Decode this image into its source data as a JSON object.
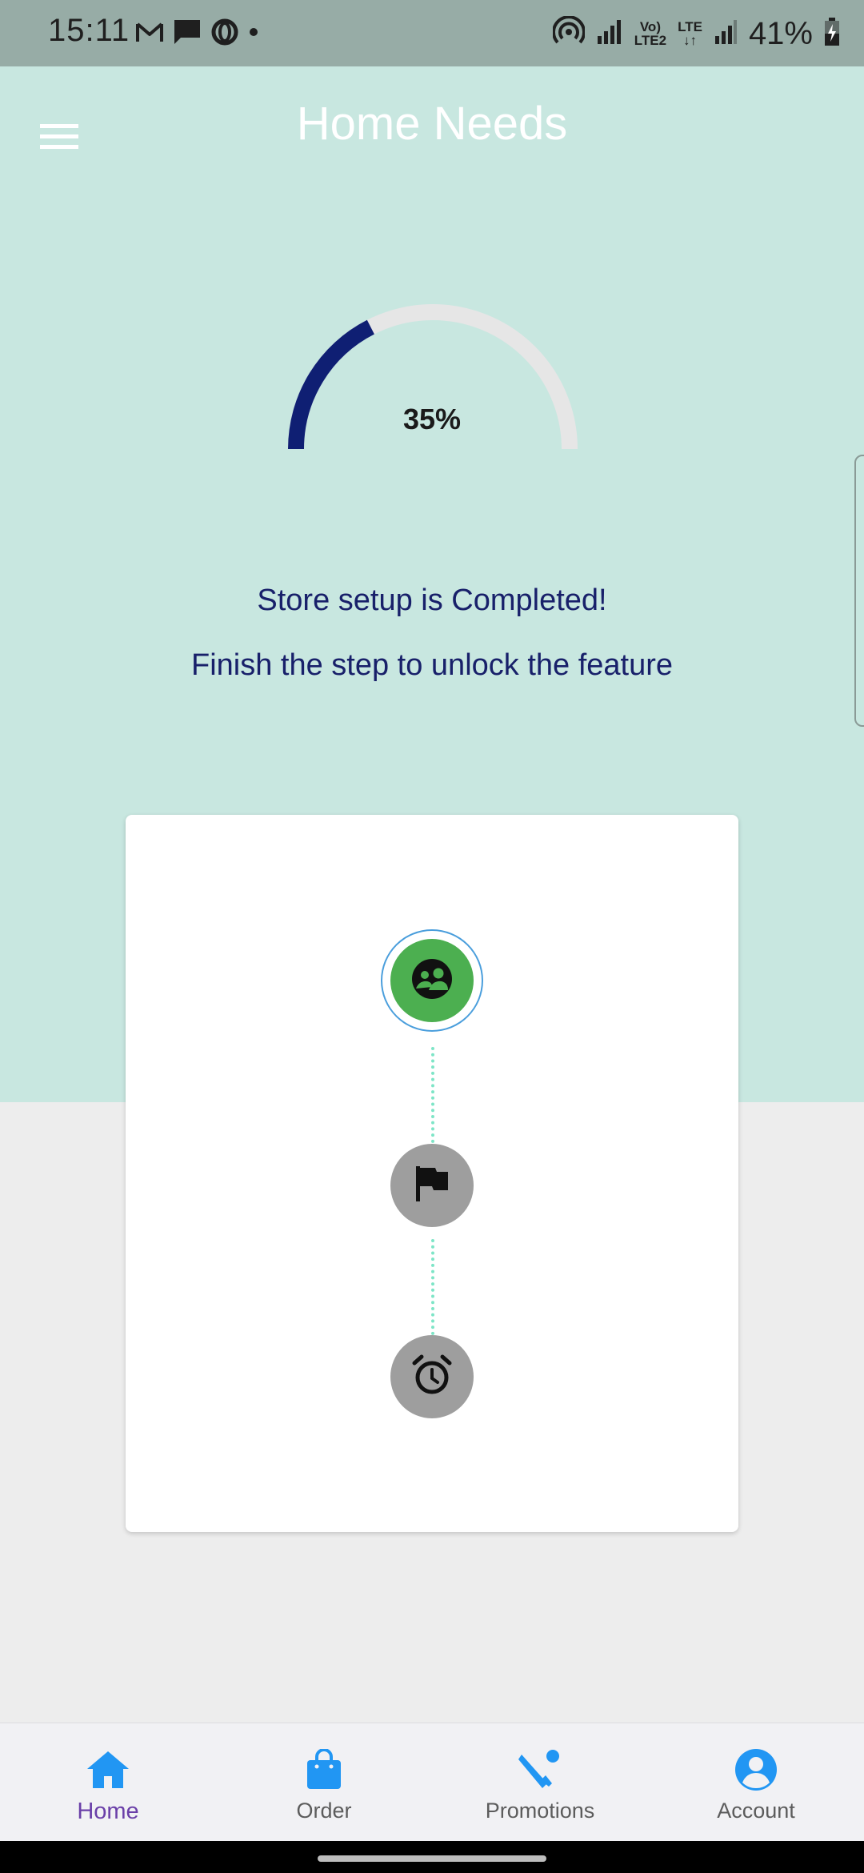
{
  "status_bar": {
    "time": "15:11",
    "battery": "41%",
    "lte_line1": "Vo)",
    "lte_line2": "LTE2",
    "lte_label": "LTE",
    "icons": [
      "gmail-icon",
      "message-icon",
      "opera-icon",
      "dot-icon",
      "hotspot-icon",
      "signal-icon",
      "signal-icon",
      "battery-charging-icon"
    ]
  },
  "header": {
    "title": "Home Needs",
    "menu_icon": "hamburger-menu-icon"
  },
  "progress": {
    "value_percent": 35,
    "label": "35%",
    "fill_color": "#0f1f73",
    "track_color": "#e6e6e6"
  },
  "messages": {
    "line1": "Store setup is Completed!",
    "line2": "Finish the step to unlock the feature"
  },
  "steps": [
    {
      "icon": "store-setup-icon",
      "status": "completed",
      "color": "#4caf50"
    },
    {
      "icon": "flag-icon",
      "status": "pending",
      "color": "#9e9e9e"
    },
    {
      "icon": "alarm-clock-icon",
      "status": "pending",
      "color": "#9e9e9e"
    }
  ],
  "bottom_nav": {
    "items": [
      {
        "label": "Home",
        "icon": "home-icon",
        "active": true
      },
      {
        "label": "Order",
        "icon": "shopping-bag-icon",
        "active": false
      },
      {
        "label": "Promotions",
        "icon": "promotions-icon",
        "active": false
      },
      {
        "label": "Account",
        "icon": "account-icon",
        "active": false
      }
    ],
    "icon_color": "#2196f3",
    "active_label_color": "#6a3fa8"
  },
  "colors": {
    "hero_background": "#c8e7e0",
    "page_background": "#ededed",
    "status_bar": "#97aca6",
    "message_text": "#18206a"
  }
}
